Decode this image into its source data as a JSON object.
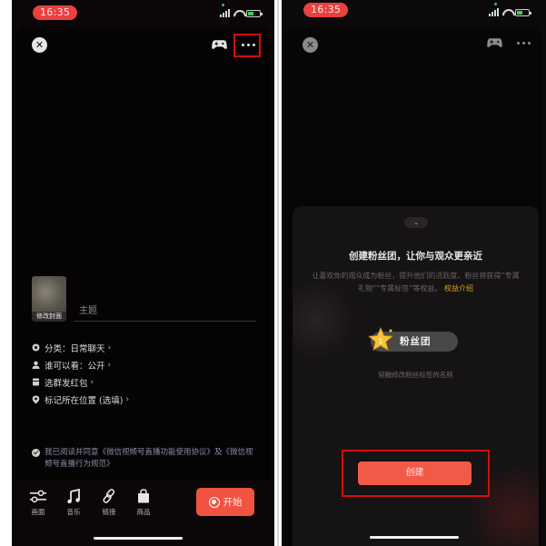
{
  "status_bar": {
    "time": "16:35"
  },
  "left_screen": {
    "cover_label": "修改封面",
    "topic_placeholder": "主题",
    "settings": [
      {
        "icon": "category-icon",
        "label": "分类：",
        "value": "日常聊天"
      },
      {
        "icon": "person-icon",
        "label": "谁可以看：",
        "value": "公开"
      },
      {
        "icon": "red-packet-icon",
        "label": "选群发红包",
        "value": ""
      },
      {
        "icon": "location-pin-icon",
        "label": "标记所在位置 (选填)",
        "value": ""
      }
    ],
    "agreement": "我已阅读并同意《微信视频号直播功能使用协议》及《微信视频号直播行为规范》",
    "toolbar": [
      {
        "icon": "sliders-icon",
        "label": "画面"
      },
      {
        "icon": "music-note-icon",
        "label": "音乐"
      },
      {
        "icon": "link-icon",
        "label": "链接"
      },
      {
        "icon": "shopping-bag-icon",
        "label": "商品"
      }
    ],
    "start_label": "开始"
  },
  "right_screen": {
    "collapse_icon": "chevron-down-icon",
    "title": "创建粉丝团，让你与观众更亲近",
    "description": "让喜欢你的观众成为粉丝，提升他们的活跃度。粉丝将获得“专属礼物”“专属标签”等权益。",
    "benefits_link": "权益介绍",
    "badge_level": "1",
    "badge_name": "粉丝团",
    "badge_hint": "轻触修改粉丝标签的名称",
    "create_label": "创建"
  },
  "colors": {
    "accent": "#f05340",
    "highlight_box": "#d30d0d",
    "link": "#e6a62a",
    "status_time_bg": "#e8413f"
  }
}
